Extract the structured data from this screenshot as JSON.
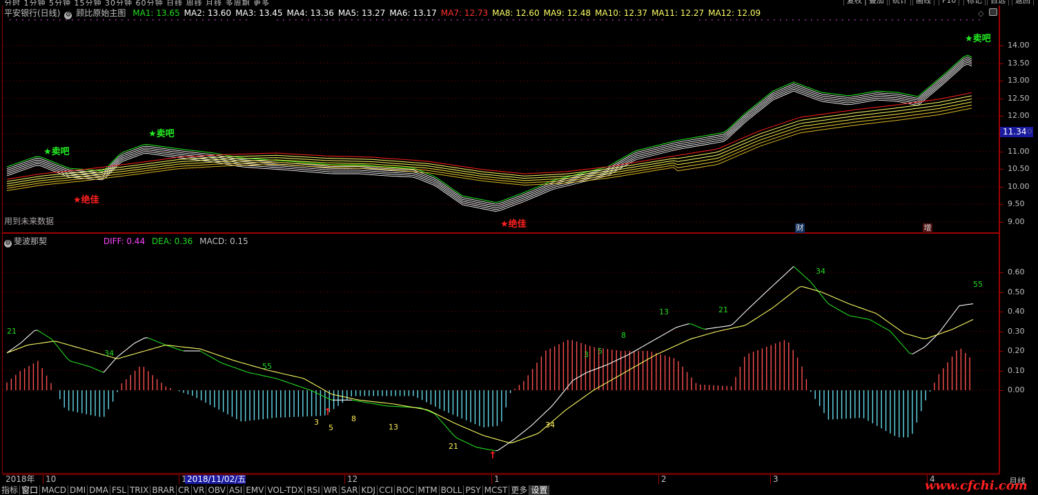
{
  "topbar": {
    "periods": "分时 1分钟 5分钟 15分钟 30分钟 60分钟 日线 周线 月线 多周期 更多",
    "buttons": [
      "复权",
      "叠加",
      "统计",
      "画线",
      "F10",
      "标记",
      "自选",
      "返回"
    ]
  },
  "main": {
    "stock_title": "平安银行(日线)",
    "indicator_name": "顾比原始主图",
    "ma_values": [
      {
        "label": "MA1: 13.65",
        "color": "#22dd22"
      },
      {
        "label": "MA2: 13.60",
        "color": "#ffffff"
      },
      {
        "label": "MA3: 13.45",
        "color": "#ffffff"
      },
      {
        "label": "MA4: 13.36",
        "color": "#ffffff"
      },
      {
        "label": "MA5: 13.27",
        "color": "#ffffff"
      },
      {
        "label": "MA6: 13.17",
        "color": "#ffffff"
      },
      {
        "label": "MA7: 12.73",
        "color": "#ff3030"
      },
      {
        "label": "MA8: 12.60",
        "color": "#ffff66"
      },
      {
        "label": "MA9: 12.48",
        "color": "#ffff66"
      },
      {
        "label": "MA10: 12.37",
        "color": "#ffff66"
      },
      {
        "label": "MA11: 12.27",
        "color": "#ffff66"
      },
      {
        "label": "MA12: 12.09",
        "color": "#ffff66"
      }
    ],
    "future_note": "用到未来数据",
    "signals": [
      {
        "text": "★卖吧",
        "color": "#22ee22"
      },
      {
        "text": "★卖吧",
        "color": "#22ee22"
      },
      {
        "text": "★卖吧",
        "color": "#22ee22"
      },
      {
        "text": "★绝佳",
        "color": "#ff2020"
      },
      {
        "text": "★绝佳",
        "color": "#ff2020"
      }
    ],
    "markers": [
      "财",
      "增"
    ],
    "y_ticks": [
      "14.00",
      "13.50",
      "13.00",
      "12.50",
      "12.00",
      "11.50",
      "11.00",
      "10.50",
      "10.00",
      "9.50",
      "9.00"
    ],
    "current_price": "11.34"
  },
  "sub": {
    "indicator_name": "斐波那契",
    "diff": "DIFF: 0.44",
    "dea": "DEA: 0.36",
    "macd": "MACD: 0.15",
    "y_ticks": [
      "0.60",
      "0.50",
      "0.40",
      "0.30",
      "0.20",
      "0.10",
      "0.00"
    ],
    "fib_green": [
      "21",
      "34",
      "55",
      "8",
      "13",
      "21",
      "34",
      "55",
      "3",
      "5"
    ],
    "fib_yellow": [
      "3",
      "5",
      "8",
      "13",
      "21",
      "34"
    ]
  },
  "dates": {
    "items": [
      "2018年",
      "10",
      "1",
      "2018/11/02/五",
      "12",
      "1",
      "2",
      "3",
      "4"
    ],
    "period_label": "月线"
  },
  "tabs": [
    "指标",
    "窗口",
    "MACD",
    "DMI",
    "DMA",
    "FSL",
    "TRIX",
    "BRAR",
    "CR",
    "VR",
    "OBV",
    "ASI",
    "EMV",
    "VOL-TDX",
    "RSI",
    "WR",
    "SAR",
    "KDJ",
    "CCI",
    "ROC",
    "MTM",
    "BOLL",
    "PSY",
    "MCST",
    "更多",
    "设置"
  ],
  "watermark": "www.cfchi.com",
  "colors": {
    "frame": "#a00000",
    "up_bar": "#ff5050",
    "down_bar": "#66ddee",
    "diff_line": "#ffffff",
    "dea_line": "#ffff66"
  }
}
